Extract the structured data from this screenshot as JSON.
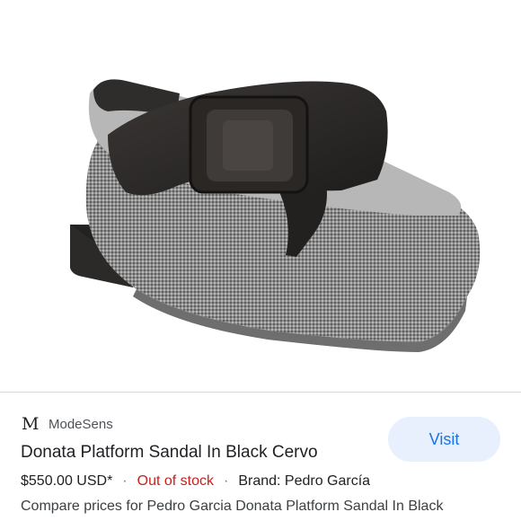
{
  "product_image": {
    "alt": ""
  },
  "result": {
    "source_logo": "M",
    "source_name": "ModeSens",
    "title": "Donata Platform Sandal In Black Cervo",
    "price": "$550.00 USD*",
    "separator": "·",
    "stock_status": "Out of stock",
    "brand": "Brand: Pedro García",
    "description": "Compare prices for Pedro Garcia Donata Platform Sandal In Black",
    "visit_label": "Visit"
  },
  "colors": {
    "stock_red": "#c5221f",
    "visit_bg": "#e8f0fe",
    "visit_text": "#1a73e8"
  }
}
